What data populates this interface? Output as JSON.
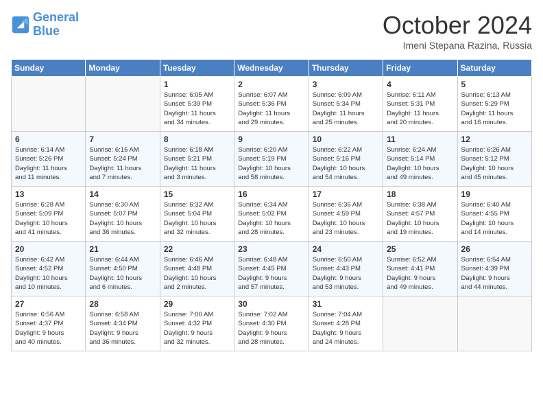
{
  "logo": {
    "line1": "General",
    "line2": "Blue"
  },
  "title": "October 2024",
  "subtitle": "Imeni Stepana Razina, Russia",
  "weekdays": [
    "Sunday",
    "Monday",
    "Tuesday",
    "Wednesday",
    "Thursday",
    "Friday",
    "Saturday"
  ],
  "weeks": [
    [
      {
        "day": "",
        "info": ""
      },
      {
        "day": "",
        "info": ""
      },
      {
        "day": "1",
        "info": "Sunrise: 6:05 AM\nSunset: 5:39 PM\nDaylight: 11 hours\nand 34 minutes."
      },
      {
        "day": "2",
        "info": "Sunrise: 6:07 AM\nSunset: 5:36 PM\nDaylight: 11 hours\nand 29 minutes."
      },
      {
        "day": "3",
        "info": "Sunrise: 6:09 AM\nSunset: 5:34 PM\nDaylight: 11 hours\nand 25 minutes."
      },
      {
        "day": "4",
        "info": "Sunrise: 6:11 AM\nSunset: 5:31 PM\nDaylight: 11 hours\nand 20 minutes."
      },
      {
        "day": "5",
        "info": "Sunrise: 6:13 AM\nSunset: 5:29 PM\nDaylight: 11 hours\nand 16 minutes."
      }
    ],
    [
      {
        "day": "6",
        "info": "Sunrise: 6:14 AM\nSunset: 5:26 PM\nDaylight: 11 hours\nand 11 minutes."
      },
      {
        "day": "7",
        "info": "Sunrise: 6:16 AM\nSunset: 5:24 PM\nDaylight: 11 hours\nand 7 minutes."
      },
      {
        "day": "8",
        "info": "Sunrise: 6:18 AM\nSunset: 5:21 PM\nDaylight: 11 hours\nand 3 minutes."
      },
      {
        "day": "9",
        "info": "Sunrise: 6:20 AM\nSunset: 5:19 PM\nDaylight: 10 hours\nand 58 minutes."
      },
      {
        "day": "10",
        "info": "Sunrise: 6:22 AM\nSunset: 5:16 PM\nDaylight: 10 hours\nand 54 minutes."
      },
      {
        "day": "11",
        "info": "Sunrise: 6:24 AM\nSunset: 5:14 PM\nDaylight: 10 hours\nand 49 minutes."
      },
      {
        "day": "12",
        "info": "Sunrise: 6:26 AM\nSunset: 5:12 PM\nDaylight: 10 hours\nand 45 minutes."
      }
    ],
    [
      {
        "day": "13",
        "info": "Sunrise: 6:28 AM\nSunset: 5:09 PM\nDaylight: 10 hours\nand 41 minutes."
      },
      {
        "day": "14",
        "info": "Sunrise: 6:30 AM\nSunset: 5:07 PM\nDaylight: 10 hours\nand 36 minutes."
      },
      {
        "day": "15",
        "info": "Sunrise: 6:32 AM\nSunset: 5:04 PM\nDaylight: 10 hours\nand 32 minutes."
      },
      {
        "day": "16",
        "info": "Sunrise: 6:34 AM\nSunset: 5:02 PM\nDaylight: 10 hours\nand 28 minutes."
      },
      {
        "day": "17",
        "info": "Sunrise: 6:36 AM\nSunset: 4:59 PM\nDaylight: 10 hours\nand 23 minutes."
      },
      {
        "day": "18",
        "info": "Sunrise: 6:38 AM\nSunset: 4:57 PM\nDaylight: 10 hours\nand 19 minutes."
      },
      {
        "day": "19",
        "info": "Sunrise: 6:40 AM\nSunset: 4:55 PM\nDaylight: 10 hours\nand 14 minutes."
      }
    ],
    [
      {
        "day": "20",
        "info": "Sunrise: 6:42 AM\nSunset: 4:52 PM\nDaylight: 10 hours\nand 10 minutes."
      },
      {
        "day": "21",
        "info": "Sunrise: 6:44 AM\nSunset: 4:50 PM\nDaylight: 10 hours\nand 6 minutes."
      },
      {
        "day": "22",
        "info": "Sunrise: 6:46 AM\nSunset: 4:48 PM\nDaylight: 10 hours\nand 2 minutes."
      },
      {
        "day": "23",
        "info": "Sunrise: 6:48 AM\nSunset: 4:45 PM\nDaylight: 9 hours\nand 57 minutes."
      },
      {
        "day": "24",
        "info": "Sunrise: 6:50 AM\nSunset: 4:43 PM\nDaylight: 9 hours\nand 53 minutes."
      },
      {
        "day": "25",
        "info": "Sunrise: 6:52 AM\nSunset: 4:41 PM\nDaylight: 9 hours\nand 49 minutes."
      },
      {
        "day": "26",
        "info": "Sunrise: 6:54 AM\nSunset: 4:39 PM\nDaylight: 9 hours\nand 44 minutes."
      }
    ],
    [
      {
        "day": "27",
        "info": "Sunrise: 6:56 AM\nSunset: 4:37 PM\nDaylight: 9 hours\nand 40 minutes."
      },
      {
        "day": "28",
        "info": "Sunrise: 6:58 AM\nSunset: 4:34 PM\nDaylight: 9 hours\nand 36 minutes."
      },
      {
        "day": "29",
        "info": "Sunrise: 7:00 AM\nSunset: 4:32 PM\nDaylight: 9 hours\nand 32 minutes."
      },
      {
        "day": "30",
        "info": "Sunrise: 7:02 AM\nSunset: 4:30 PM\nDaylight: 9 hours\nand 28 minutes."
      },
      {
        "day": "31",
        "info": "Sunrise: 7:04 AM\nSunset: 4:28 PM\nDaylight: 9 hours\nand 24 minutes."
      },
      {
        "day": "",
        "info": ""
      },
      {
        "day": "",
        "info": ""
      }
    ]
  ]
}
